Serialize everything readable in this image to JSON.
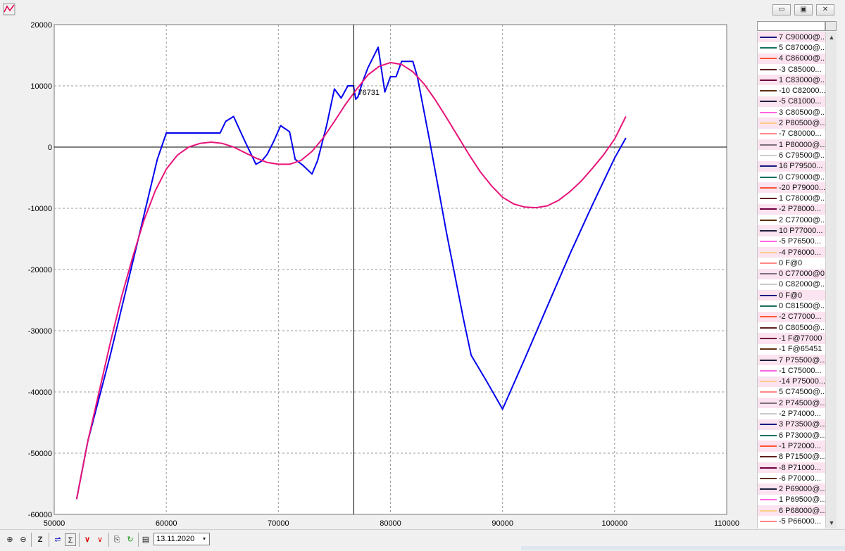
{
  "window": {
    "controls": [
      "▭",
      "▣",
      "✕"
    ]
  },
  "chart_data": {
    "type": "line",
    "xlim": [
      50000,
      110000
    ],
    "ylim": [
      -60000,
      20000
    ],
    "x_ticks": [
      50000,
      60000,
      70000,
      80000,
      90000,
      100000,
      110000
    ],
    "y_ticks": [
      20000,
      10000,
      0,
      -10000,
      -20000,
      -30000,
      -40000,
      -50000,
      -60000
    ],
    "grid": true,
    "cursor": {
      "x": 76731,
      "label": "76731"
    },
    "series": [
      {
        "color": "#0000ee",
        "points": [
          [
            52000,
            -57500
          ],
          [
            53000,
            -48000
          ],
          [
            55000,
            -34000
          ],
          [
            57500,
            -15000
          ],
          [
            59200,
            -2000
          ],
          [
            60000,
            2300
          ],
          [
            64800,
            2300
          ],
          [
            65300,
            4200
          ],
          [
            66000,
            5000
          ],
          [
            67000,
            1000
          ],
          [
            68000,
            -2800
          ],
          [
            68500,
            -2300
          ],
          [
            69000,
            -1200
          ],
          [
            69600,
            1000
          ],
          [
            70200,
            3500
          ],
          [
            71000,
            2500
          ],
          [
            71500,
            -2000
          ],
          [
            72200,
            -3000
          ],
          [
            73000,
            -4400
          ],
          [
            73500,
            -2200
          ],
          [
            74300,
            3500
          ],
          [
            75000,
            9500
          ],
          [
            75600,
            8000
          ],
          [
            76200,
            10000
          ],
          [
            76700,
            10000
          ],
          [
            76900,
            7800
          ],
          [
            77100,
            8200
          ],
          [
            77500,
            10600
          ],
          [
            78000,
            13000
          ],
          [
            78900,
            16300
          ],
          [
            79500,
            9000
          ],
          [
            80000,
            11500
          ],
          [
            80500,
            11500
          ],
          [
            81000,
            14000
          ],
          [
            82000,
            14000
          ],
          [
            82400,
            11500
          ],
          [
            83500,
            1000
          ],
          [
            85000,
            -14000
          ],
          [
            86500,
            -28000
          ],
          [
            87200,
            -34000
          ],
          [
            88500,
            -38000
          ],
          [
            90000,
            -42800
          ],
          [
            92000,
            -34500
          ],
          [
            94000,
            -26000
          ],
          [
            96000,
            -17500
          ],
          [
            98000,
            -9500
          ],
          [
            100000,
            -1800
          ],
          [
            101000,
            1500
          ]
        ]
      },
      {
        "color": "#e8147a",
        "points": [
          [
            52000,
            -57500
          ],
          [
            53000,
            -48000
          ],
          [
            54000,
            -40000
          ],
          [
            55000,
            -32000
          ],
          [
            56000,
            -24500
          ],
          [
            57000,
            -18000
          ],
          [
            58000,
            -12000
          ],
          [
            59000,
            -7200
          ],
          [
            60000,
            -3600
          ],
          [
            61000,
            -1300
          ],
          [
            62000,
            0
          ],
          [
            63000,
            600
          ],
          [
            64000,
            800
          ],
          [
            65000,
            600
          ],
          [
            66000,
            0
          ],
          [
            67000,
            -900
          ],
          [
            68000,
            -1800
          ],
          [
            69000,
            -2500
          ],
          [
            70000,
            -2800
          ],
          [
            71000,
            -2800
          ],
          [
            72000,
            -2200
          ],
          [
            73000,
            -700
          ],
          [
            74000,
            1500
          ],
          [
            75000,
            4200
          ],
          [
            76000,
            7000
          ],
          [
            77000,
            9500
          ],
          [
            78000,
            11800
          ],
          [
            79000,
            13200
          ],
          [
            80000,
            13800
          ],
          [
            81000,
            13500
          ],
          [
            82000,
            12300
          ],
          [
            83000,
            10300
          ],
          [
            84000,
            7700
          ],
          [
            85000,
            4800
          ],
          [
            86000,
            1800
          ],
          [
            87000,
            -1200
          ],
          [
            88000,
            -4000
          ],
          [
            89000,
            -6300
          ],
          [
            90000,
            -8200
          ],
          [
            91000,
            -9300
          ],
          [
            92000,
            -9800
          ],
          [
            93000,
            -9900
          ],
          [
            94000,
            -9600
          ],
          [
            95000,
            -8700
          ],
          [
            96000,
            -7300
          ],
          [
            97000,
            -5600
          ],
          [
            98000,
            -3500
          ],
          [
            99000,
            -1300
          ],
          [
            100000,
            1300
          ],
          [
            101000,
            5000
          ]
        ]
      }
    ]
  },
  "legend": {
    "items": [
      {
        "label": "7 C90000@...",
        "color": "#1a1a80"
      },
      {
        "label": "5 C87000@...",
        "color": "#1a7060"
      },
      {
        "label": "4 C86000@...",
        "color": "#ff5533"
      },
      {
        "label": "-3 C85000...",
        "color": "#602020"
      },
      {
        "label": "1 C83000@...",
        "color": "#700040"
      },
      {
        "label": "-10 C82000...",
        "color": "#603010"
      },
      {
        "label": "-5 C81000...",
        "color": "#202040"
      },
      {
        "label": "3 C80500@...",
        "color": "#ff66dd"
      },
      {
        "label": "2 P80500@...",
        "color": "#ffcc88"
      },
      {
        "label": "-7 C80000...",
        "color": "#ff8888"
      },
      {
        "label": "1 P80000@...",
        "color": "#807080"
      },
      {
        "label": "6 C79500@...",
        "color": "#cccccc"
      },
      {
        "label": "16 P79500...",
        "color": "#1a1a80"
      },
      {
        "label": "0 C79000@...",
        "color": "#1a7060"
      },
      {
        "label": "-20 P79000...",
        "color": "#ff5533"
      },
      {
        "label": "1 C78000@...",
        "color": "#602020"
      },
      {
        "label": "-2 P78000...",
        "color": "#700040"
      },
      {
        "label": "2 C77000@...",
        "color": "#603010"
      },
      {
        "label": "10 P77000...",
        "color": "#202040"
      },
      {
        "label": "-5 P76500...",
        "color": "#ff66dd"
      },
      {
        "label": "-4 P76000...",
        "color": "#ffcc88"
      },
      {
        "label": "0 F@0",
        "color": "#ff8888"
      },
      {
        "label": "0 C77000@0",
        "color": "#807080"
      },
      {
        "label": "0 C82000@...",
        "color": "#cccccc"
      },
      {
        "label": "0 F@0",
        "color": "#1a1a80"
      },
      {
        "label": "0 C81500@...",
        "color": "#1a7060"
      },
      {
        "label": "-2 C77000...",
        "color": "#ff5533"
      },
      {
        "label": "0 C80500@...",
        "color": "#602020"
      },
      {
        "label": "-1 F@77000",
        "color": "#700040"
      },
      {
        "label": "-1 F@65451",
        "color": "#603010"
      },
      {
        "label": "7 P75500@...",
        "color": "#202040"
      },
      {
        "label": "-1 C75000...",
        "color": "#ff66dd"
      },
      {
        "label": "-14 P75000...",
        "color": "#ffcc88"
      },
      {
        "label": "5 C74500@...",
        "color": "#ff8888"
      },
      {
        "label": "2 P74500@...",
        "color": "#807080"
      },
      {
        "label": "-2 P74000...",
        "color": "#cccccc"
      },
      {
        "label": "3 P73500@...",
        "color": "#1a1a80"
      },
      {
        "label": "6 P73000@...",
        "color": "#1a7060"
      },
      {
        "label": "-1 P72000...",
        "color": "#ff5533"
      },
      {
        "label": "8 P71500@...",
        "color": "#602020"
      },
      {
        "label": "-8 P71000...",
        "color": "#700040"
      },
      {
        "label": "-6 P70000...",
        "color": "#603010"
      },
      {
        "label": "2 P69000@...",
        "color": "#202040"
      },
      {
        "label": "1 P69500@...",
        "color": "#ff66dd"
      },
      {
        "label": "6 P68000@...",
        "color": "#ffcc88"
      },
      {
        "label": "-5 P66000...",
        "color": "#ff8888"
      }
    ]
  },
  "toolbar": {
    "zoom_label": "Z",
    "sum_label": "Σ",
    "date_value": "13.11.2020",
    "icons": [
      "⊕",
      "⊖",
      "⇌",
      "∨",
      "∨",
      "⎘",
      "↻",
      "▤",
      "▾"
    ]
  }
}
